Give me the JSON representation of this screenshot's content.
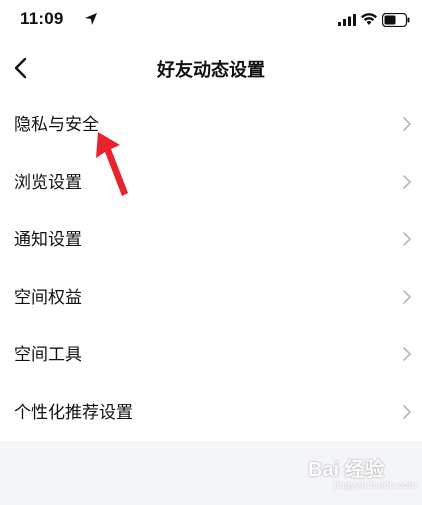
{
  "status_bar": {
    "time": "11:09"
  },
  "nav": {
    "title": "好友动态设置"
  },
  "settings": {
    "items": [
      {
        "label": "隐私与安全"
      },
      {
        "label": "浏览设置"
      },
      {
        "label": "通知设置"
      },
      {
        "label": "空间权益"
      },
      {
        "label": "空间工具"
      },
      {
        "label": "个性化推荐设置"
      }
    ]
  },
  "watermark": {
    "text": "Bai 经验",
    "url": "jingyan.baidu.com"
  },
  "colors": {
    "annotation_arrow": "#e8232c",
    "chevron": "#b5b7bc",
    "page_background": "#f4f5f8"
  }
}
